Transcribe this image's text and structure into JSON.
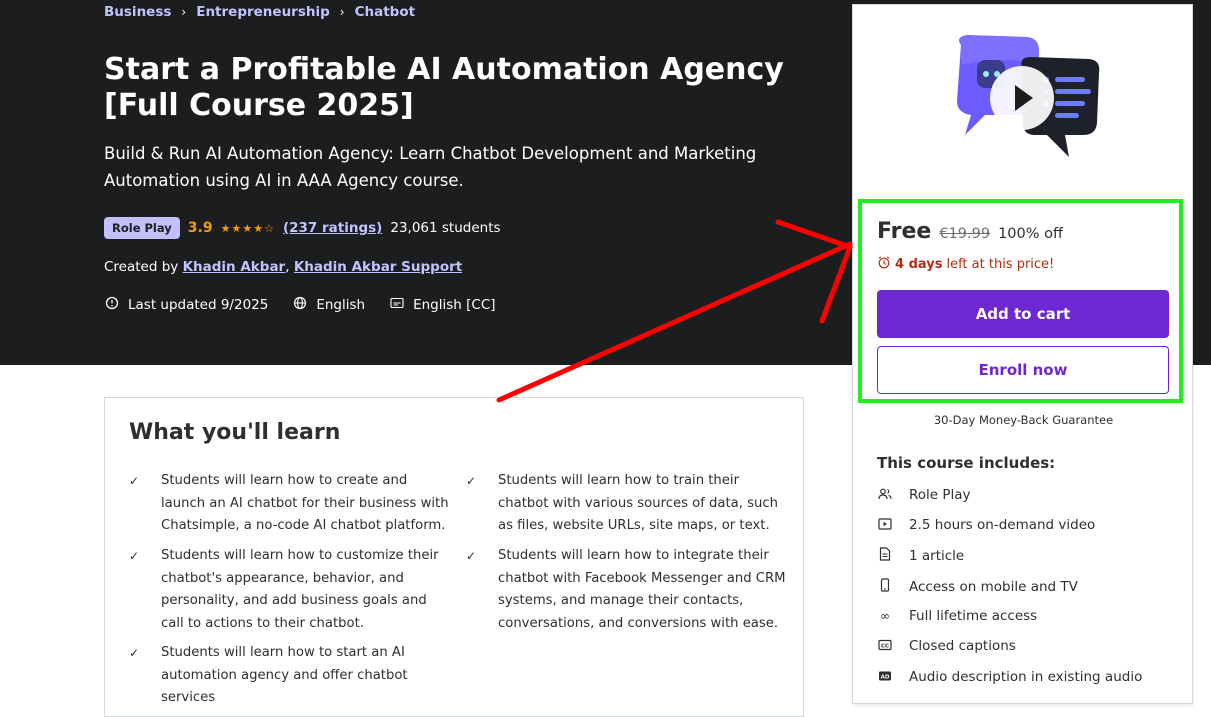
{
  "breadcrumb": [
    "Business",
    "Entrepreneurship",
    "Chatbot"
  ],
  "course": {
    "title": "Start a Profitable AI Automation Agency [Full Course 2025]",
    "subtitle": "Build & Run AI Automation Agency: Learn Chatbot Development and Marketing Automation using AI in AAA Agency course.",
    "badge": "Role Play",
    "rating": "3.9",
    "stars_value": 3.9,
    "ratings_count": "(237 ratings)",
    "students": "23,061 students",
    "created_by_label": "Created by",
    "authors": [
      "Khadin Akbar",
      "Khadin Akbar Support"
    ],
    "last_updated": "Last updated 9/2025",
    "language": "English",
    "captions": "English [CC]"
  },
  "learn": {
    "title": "What you'll learn",
    "items": [
      "Students will learn how to create and launch an AI chatbot for their business with Chatsimple, a no-code AI chatbot platform.",
      "Students will learn how to train their chatbot with various sources of data, such as files, website URLs, site maps, or text.",
      "Students will learn how to customize their chatbot's appearance, behavior, and personality, and add business goals and call to actions to their chatbot.",
      "Students will learn how to integrate their chatbot with Facebook Messenger and CRM systems, and manage their contacts, conversations, and conversions with ease.",
      "Students will learn how to start an AI automation agency and offer chatbot services"
    ]
  },
  "sidebar": {
    "price": "Free",
    "original_price": "€19.99",
    "discount": "100% off",
    "timer_bold": "4 days",
    "timer_rest": "left at this price!",
    "add_to_cart": "Add to cart",
    "enroll_now": "Enroll now",
    "guarantee": "30-Day Money-Back Guarantee",
    "includes_title": "This course includes:",
    "includes": [
      {
        "icon": "role-play-icon",
        "label": "Role Play"
      },
      {
        "icon": "video-icon",
        "label": "2.5 hours on-demand video"
      },
      {
        "icon": "article-icon",
        "label": "1 article"
      },
      {
        "icon": "mobile-icon",
        "label": "Access on mobile and TV"
      },
      {
        "icon": "infinity-icon",
        "label": "Full lifetime access"
      },
      {
        "icon": "captions-icon",
        "label": "Closed captions"
      },
      {
        "icon": "audio-description-icon",
        "label": "Audio description in existing audio"
      }
    ]
  },
  "colors": {
    "hero_bg": "#1c1d1f",
    "link": "#c0c4fc",
    "rating": "#f69c08",
    "primary": "#6d28d2",
    "timer": "#b32d0f",
    "highlight": "#1ff020",
    "arrow": "#ff0000"
  }
}
